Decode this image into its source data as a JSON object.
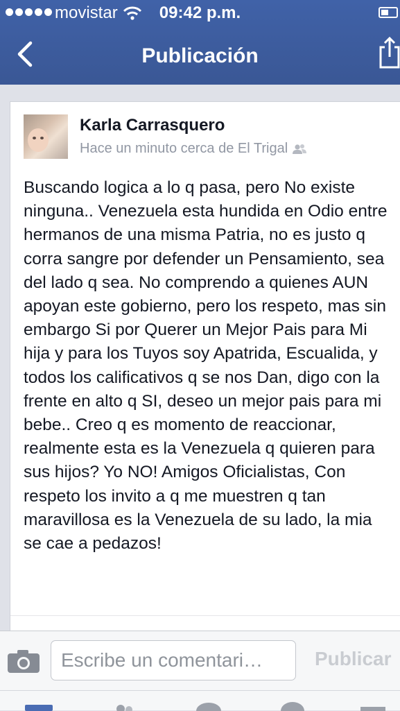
{
  "status_bar": {
    "carrier": "movistar",
    "time": "09:42 p.m.",
    "icons": [
      "signal-dots-icon",
      "wifi-icon",
      "battery-icon"
    ]
  },
  "nav": {
    "title": "Publicación",
    "back_icon": "chevron-left-icon",
    "share_icon": "share-icon"
  },
  "post": {
    "author": "Karla Carrasquero",
    "meta": "Hace un minuto cerca de El Trigal",
    "audience_icon": "friends-icon",
    "text": "Buscando logica a lo q pasa, pero No existe ninguna.. Venezuela esta hundida en Odio entre hermanos de una misma Patria, no es justo q corra sangre por defender un Pensamiento, sea del lado q sea. No comprendo a quienes AUN apoyan este gobierno, pero los respeto, mas sin embargo Si por Querer un Mejor Pais para Mi hija y para los Tuyos soy Apatrida, Escualida, y todos los calificativos q se nos Dan, digo con la frente en alto q SI, deseo un mejor pais para mi bebe.. Creo q es momento de reaccionar, realmente esta es la Venezuela q quieren para sus hijos? Yo NO! Amigos Oficialistas, Con respeto los invito a q me muestren q tan maravillosa es la Venezuela de su lado, la mia se cae a pedazos!"
  },
  "comment_bar": {
    "placeholder": "Escribe un comentari…",
    "publish_label": "Publicar",
    "camera_icon": "camera-icon"
  },
  "colors": {
    "header_blue": "#3b5998",
    "text": "#141823",
    "meta_gray": "#9197a3"
  }
}
